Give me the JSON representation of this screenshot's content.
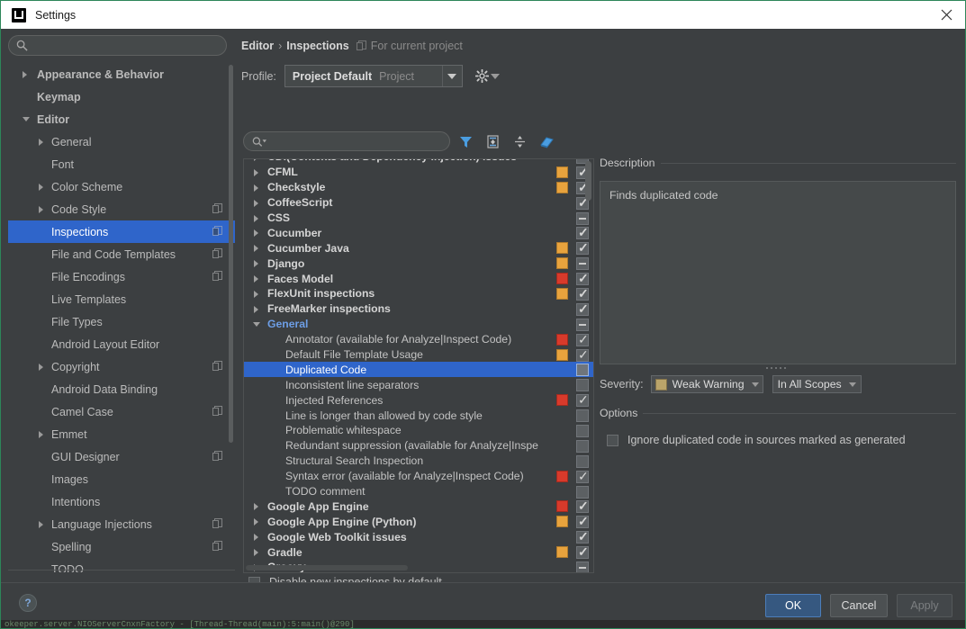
{
  "window": {
    "title": "Settings",
    "app_icon": "intellij-idea-icon",
    "close_icon": "close-icon"
  },
  "sidebar": {
    "search": {
      "value": "",
      "placeholder": "",
      "icon": "search-icon"
    },
    "items": [
      {
        "label": "Appearance & Behavior",
        "level": 1,
        "arrow": "right",
        "copy": false,
        "selected": false
      },
      {
        "label": "Keymap",
        "level": 1,
        "arrow": "none",
        "copy": false,
        "selected": false
      },
      {
        "label": "Editor",
        "level": 1,
        "arrow": "down",
        "copy": false,
        "selected": false
      },
      {
        "label": "General",
        "level": 2,
        "arrow": "right",
        "copy": false,
        "selected": false
      },
      {
        "label": "Font",
        "level": 2,
        "arrow": "none",
        "copy": false,
        "selected": false
      },
      {
        "label": "Color Scheme",
        "level": 2,
        "arrow": "right",
        "copy": false,
        "selected": false
      },
      {
        "label": "Code Style",
        "level": 2,
        "arrow": "right",
        "copy": true,
        "selected": false
      },
      {
        "label": "Inspections",
        "level": 2,
        "arrow": "none",
        "copy": true,
        "selected": true
      },
      {
        "label": "File and Code Templates",
        "level": 2,
        "arrow": "none",
        "copy": true,
        "selected": false
      },
      {
        "label": "File Encodings",
        "level": 2,
        "arrow": "none",
        "copy": true,
        "selected": false
      },
      {
        "label": "Live Templates",
        "level": 2,
        "arrow": "none",
        "copy": false,
        "selected": false
      },
      {
        "label": "File Types",
        "level": 2,
        "arrow": "none",
        "copy": false,
        "selected": false
      },
      {
        "label": "Android Layout Editor",
        "level": 2,
        "arrow": "none",
        "copy": false,
        "selected": false
      },
      {
        "label": "Copyright",
        "level": 2,
        "arrow": "right",
        "copy": true,
        "selected": false
      },
      {
        "label": "Android Data Binding",
        "level": 2,
        "arrow": "none",
        "copy": false,
        "selected": false
      },
      {
        "label": "Camel Case",
        "level": 2,
        "arrow": "none",
        "copy": true,
        "selected": false
      },
      {
        "label": "Emmet",
        "level": 2,
        "arrow": "right",
        "copy": false,
        "selected": false
      },
      {
        "label": "GUI Designer",
        "level": 2,
        "arrow": "none",
        "copy": true,
        "selected": false
      },
      {
        "label": "Images",
        "level": 2,
        "arrow": "none",
        "copy": false,
        "selected": false
      },
      {
        "label": "Intentions",
        "level": 2,
        "arrow": "none",
        "copy": false,
        "selected": false
      },
      {
        "label": "Language Injections",
        "level": 2,
        "arrow": "right",
        "copy": true,
        "selected": false
      },
      {
        "label": "Spelling",
        "level": 2,
        "arrow": "none",
        "copy": true,
        "selected": false
      },
      {
        "label": "TODO",
        "level": 2,
        "arrow": "none",
        "copy": false,
        "selected": false
      }
    ]
  },
  "breadcrumb": {
    "root": "Editor",
    "separator": "›",
    "current": "Inspections",
    "scope_icon": "copy-project-icon",
    "scope_note": "For current project"
  },
  "profile": {
    "label": "Profile:",
    "name": "Project Default",
    "scope": "Project",
    "dropdown_icon": "chevron-down-icon",
    "gear_icon": "gear-icon"
  },
  "inspections_toolbar": {
    "search": {
      "value": "",
      "placeholder": "",
      "icon": "search-dropdown-icon"
    },
    "buttons": [
      {
        "name": "filter-icon",
        "title": "Filter inspections"
      },
      {
        "name": "expand-all-icon",
        "title": "Expand all"
      },
      {
        "name": "collapse-all-icon",
        "title": "Collapse all"
      },
      {
        "name": "reset-icon",
        "title": "Reset to defaults"
      }
    ]
  },
  "tree": {
    "rows": [
      {
        "label": "CDI(Contexts and Dependency Injection) issues",
        "type": "group",
        "arrow": "right",
        "severity": null,
        "check": "dash",
        "clipped": true
      },
      {
        "label": "CFML",
        "type": "group",
        "arrow": "right",
        "severity": "#e8a33d",
        "check": "check"
      },
      {
        "label": "Checkstyle",
        "type": "group",
        "arrow": "right",
        "severity": "#e8a33d",
        "check": "check"
      },
      {
        "label": "CoffeeScript",
        "type": "group",
        "arrow": "right",
        "severity": null,
        "check": "check"
      },
      {
        "label": "CSS",
        "type": "group",
        "arrow": "right",
        "severity": null,
        "check": "dash"
      },
      {
        "label": "Cucumber",
        "type": "group",
        "arrow": "right",
        "severity": null,
        "check": "check"
      },
      {
        "label": "Cucumber Java",
        "type": "group",
        "arrow": "right",
        "severity": "#e8a33d",
        "check": "check"
      },
      {
        "label": "Django",
        "type": "group",
        "arrow": "right",
        "severity": "#e8a33d",
        "check": "dash"
      },
      {
        "label": "Faces Model",
        "type": "group",
        "arrow": "right",
        "severity": "#d83a2b",
        "check": "check"
      },
      {
        "label": "FlexUnit inspections",
        "type": "group",
        "arrow": "right",
        "severity": "#e8a33d",
        "check": "check"
      },
      {
        "label": "FreeMarker inspections",
        "type": "group",
        "arrow": "right",
        "severity": null,
        "check": "check"
      },
      {
        "label": "General",
        "type": "general",
        "arrow": "down",
        "severity": null,
        "check": "dash"
      },
      {
        "label": "Annotator (available for Analyze|Inspect Code)",
        "type": "leaf",
        "arrow": "none",
        "severity": "#d83a2b",
        "check": "check"
      },
      {
        "label": "Default File Template Usage",
        "type": "leaf",
        "arrow": "none",
        "severity": "#e8a33d",
        "check": "check"
      },
      {
        "label": "Duplicated Code",
        "type": "leaf",
        "arrow": "none",
        "severity": null,
        "check": "empty",
        "selected": true
      },
      {
        "label": "Inconsistent line separators",
        "type": "leaf",
        "arrow": "none",
        "severity": null,
        "check": "empty"
      },
      {
        "label": "Injected References",
        "type": "leaf",
        "arrow": "none",
        "severity": "#d83a2b",
        "check": "check"
      },
      {
        "label": "Line is longer than allowed by code style",
        "type": "leaf",
        "arrow": "none",
        "severity": null,
        "check": "empty"
      },
      {
        "label": "Problematic whitespace",
        "type": "leaf",
        "arrow": "none",
        "severity": null,
        "check": "empty"
      },
      {
        "label": "Redundant suppression (available for Analyze|Inspe",
        "type": "leaf",
        "arrow": "none",
        "severity": null,
        "check": "empty"
      },
      {
        "label": "Structural Search Inspection",
        "type": "leaf",
        "arrow": "none",
        "severity": null,
        "check": "empty"
      },
      {
        "label": "Syntax error (available for Analyze|Inspect Code)",
        "type": "leaf",
        "arrow": "none",
        "severity": "#d83a2b",
        "check": "check"
      },
      {
        "label": "TODO comment",
        "type": "leaf",
        "arrow": "none",
        "severity": null,
        "check": "empty"
      },
      {
        "label": "Google App Engine",
        "type": "group",
        "arrow": "right",
        "severity": "#d83a2b",
        "check": "check"
      },
      {
        "label": "Google App Engine (Python)",
        "type": "group",
        "arrow": "right",
        "severity": "#e8a33d",
        "check": "check"
      },
      {
        "label": "Google Web Toolkit issues",
        "type": "group",
        "arrow": "right",
        "severity": null,
        "check": "check"
      },
      {
        "label": "Gradle",
        "type": "group",
        "arrow": "right",
        "severity": "#e8a33d",
        "check": "check"
      },
      {
        "label": "Groovy",
        "type": "group",
        "arrow": "right",
        "severity": null,
        "check": "dash",
        "clipped": true
      }
    ]
  },
  "disable_new": {
    "label": "Disable new inspections by default",
    "checked": false
  },
  "description": {
    "group_title": "Description",
    "text": "Finds duplicated code"
  },
  "severity": {
    "label": "Severity:",
    "value": "Weak Warning",
    "swatch_color": "#baa46a",
    "scope_value": "In All Scopes"
  },
  "options": {
    "group_title": "Options",
    "items": [
      {
        "label": "Ignore duplicated code in sources marked as generated",
        "checked": false
      }
    ]
  },
  "footer": {
    "help_label": "?",
    "ok_label": "OK",
    "cancel_label": "Cancel",
    "apply_label": "Apply"
  },
  "background_sliver": {
    "text": "okeeper.server.NIOServerCnxnFactory  - [Thread-Thread(main):5:main()@290]"
  },
  "colors": {
    "window_bg": "#3c3f41",
    "panel_bg": "#45494a",
    "selection_blue": "#2f65ca",
    "accent_ok": "#365880",
    "severity_error": "#d83a2b",
    "severity_warning": "#e8a33d",
    "general_link": "#6d9ee6"
  }
}
